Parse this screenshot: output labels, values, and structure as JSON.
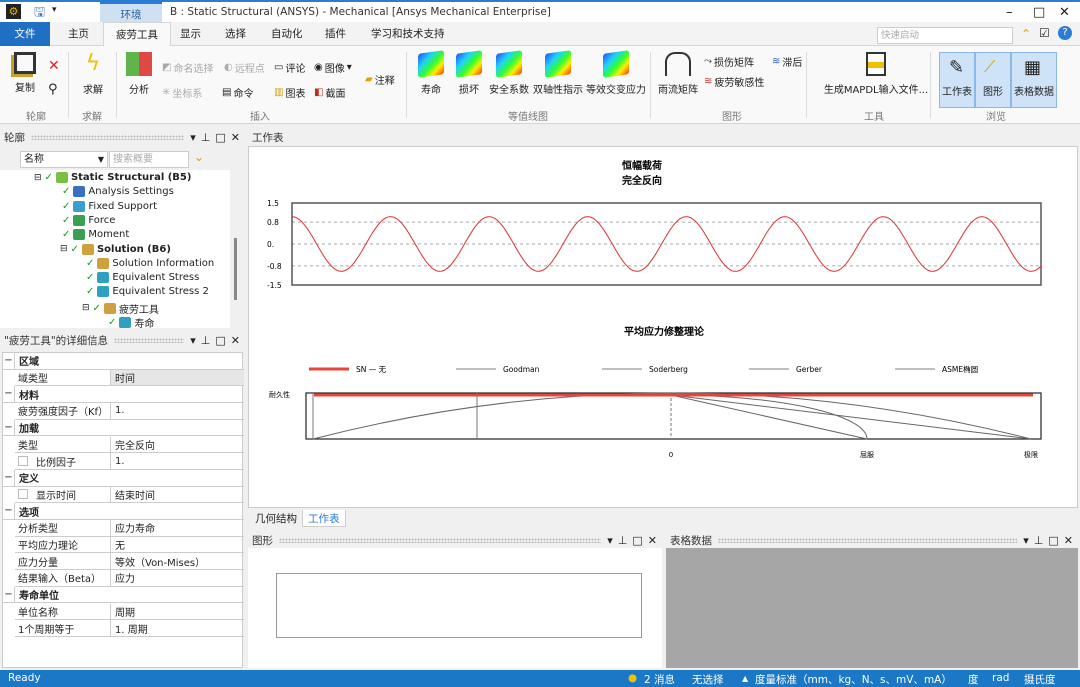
{
  "titlebar": {
    "title": "B : Static Structural (ANSYS) - Mechanical [Ansys Mechanical Enterprise]",
    "context_tab": "环境",
    "min": "–",
    "max": "□",
    "close": "✕"
  },
  "tabs": [
    {
      "label": "文件"
    },
    {
      "label": "主页"
    },
    {
      "label": "疲劳工具"
    },
    {
      "label": "显示"
    },
    {
      "label": "选择"
    },
    {
      "label": "自动化"
    },
    {
      "label": "插件"
    },
    {
      "label": "学习和技术支持"
    }
  ],
  "active_tab": "疲劳工具",
  "quick_launch": {
    "placeholder": "快速启动"
  },
  "ribbon": {
    "outline": {
      "copy": "复制",
      "label": "轮廓"
    },
    "solve": {
      "solve": "求解",
      "label": "求解"
    },
    "insert": {
      "analysis": "分析",
      "named_sel": "命名选择",
      "remote_point": "远程点",
      "comment": "评论",
      "image": "图像",
      "coord": "坐标系",
      "command": "命令",
      "chart": "图表",
      "section": "截面",
      "annotation": "注释",
      "label": "插入"
    },
    "contour": {
      "items": [
        "寿命",
        "损坏",
        "安全系数",
        "双轴性指示",
        "等效交变应力"
      ],
      "label": "等值线图"
    },
    "graph": {
      "rainflow": "雨流矩阵",
      "damage_matrix": "损伤矩阵",
      "sensitivity": "疲劳敏感性",
      "hysteresis": "滞后",
      "label": "图形"
    },
    "tools": {
      "mapdl": "生成MAPDL输入文件...",
      "label": "工具"
    },
    "browse": {
      "worksheet": "工作表",
      "graph": "图形",
      "tabular": "表格数据",
      "label": "浏览"
    }
  },
  "outline": {
    "title": "轮廓",
    "filter": "名称",
    "search_placeholder": "搜索概要",
    "tree": [
      {
        "label": "Static Structural (B5)",
        "bold": true
      },
      {
        "label": "Analysis Settings"
      },
      {
        "label": "Fixed Support"
      },
      {
        "label": "Force"
      },
      {
        "label": "Moment"
      },
      {
        "label": "Solution (B6)",
        "bold": true
      },
      {
        "label": "Solution Information"
      },
      {
        "label": "Equivalent Stress"
      },
      {
        "label": "Equivalent Stress 2"
      },
      {
        "label": "疲劳工具"
      },
      {
        "label": "寿命"
      }
    ]
  },
  "details": {
    "title": "\"疲劳工具\"的详细信息",
    "sections": [
      {
        "name": "区域",
        "rows": [
          {
            "k": "域类型",
            "v": "时间"
          }
        ]
      },
      {
        "name": "材料",
        "rows": [
          {
            "k": "疲劳强度因子（Kf）",
            "v": "1."
          }
        ]
      },
      {
        "name": "加载",
        "rows": [
          {
            "k": "类型",
            "v": "完全反向"
          },
          {
            "k": "比例因子",
            "v": "1.",
            "checkbox": true
          }
        ]
      },
      {
        "name": "定义",
        "rows": [
          {
            "k": "显示时间",
            "v": "结束时间",
            "checkbox": true
          }
        ]
      },
      {
        "name": "选项",
        "rows": [
          {
            "k": "分析类型",
            "v": "应力寿命"
          },
          {
            "k": "平均应力理论",
            "v": "无"
          },
          {
            "k": "应力分量",
            "v": "等效（Von-Mises）"
          },
          {
            "k": "结果输入（Beta）",
            "v": "应力"
          }
        ]
      },
      {
        "name": "寿命单位",
        "rows": [
          {
            "k": "单位名称",
            "v": "周期"
          },
          {
            "k": "1个周期等于",
            "v": "1. 周期"
          }
        ]
      }
    ]
  },
  "worksheet": {
    "title": "工作表"
  },
  "chart_data": [
    {
      "type": "line",
      "title": "恒幅载荷",
      "subtitle": "完全反向",
      "yticks": [
        "1.5",
        "0.8",
        "0.",
        "-0.8",
        "-1.5"
      ],
      "ylim": [
        -1.5,
        1.5
      ],
      "grid": "dashed at 0.8, 0, -0.8",
      "series": [
        {
          "function": "cos",
          "amplitude": 1,
          "cycles": 7.6,
          "color": "#e03030"
        }
      ]
    },
    {
      "type": "line",
      "title": "平均应力修整理论",
      "legend": [
        "SN — 无",
        "Goodman",
        "Soderberg",
        "Gerber",
        "ASME椭圆"
      ],
      "legend_placement": "top",
      "ylabel": "耐久性",
      "xticks": [
        "0",
        "屈服",
        "极限"
      ],
      "colors": {
        "sn": "#e8443a",
        "others": "#555555"
      }
    }
  ],
  "bottom_tabs": [
    "几何结构",
    "工作表"
  ],
  "panels": {
    "graph": "图形",
    "tabular": "表格数据"
  },
  "status": {
    "ready": "Ready",
    "messages": "2 消息",
    "selection": "无选择",
    "units": "度量标准（mm、kg、N、s、mV、mA）",
    "angle": "度",
    "rad": "rad",
    "temp": "摄氏度"
  }
}
